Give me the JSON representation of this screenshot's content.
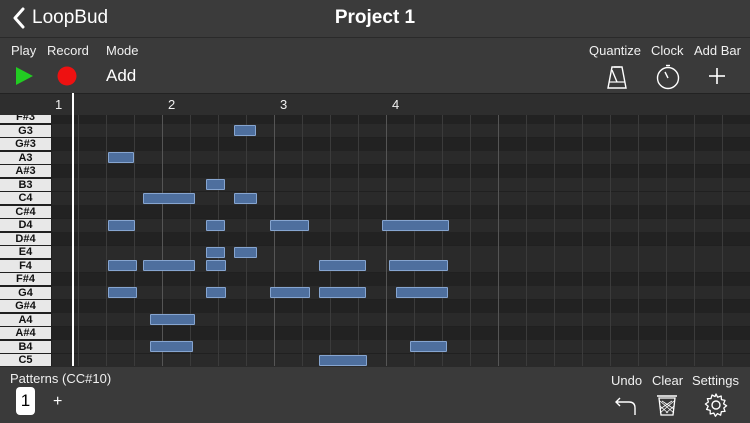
{
  "nav": {
    "back_label": "LoopBud",
    "title": "Project 1"
  },
  "toolbar": {
    "play_label": "Play",
    "record_label": "Record",
    "mode_label": "Mode",
    "mode_value": "Add",
    "quantize_label": "Quantize",
    "clock_label": "Clock",
    "addbar_label": "Add Bar",
    "colors": {
      "play": "#22cc22",
      "record": "#ee1111"
    }
  },
  "ruler": {
    "bars": [
      "1",
      "2",
      "3",
      "4"
    ]
  },
  "keys": [
    "F#3",
    "G3",
    "G#3",
    "A3",
    "A#3",
    "B3",
    "C4",
    "C#4",
    "D4",
    "D#4",
    "E4",
    "F4",
    "F#4",
    "G4",
    "G#4",
    "A4",
    "A#4",
    "B4",
    "C5"
  ],
  "bottom": {
    "patterns_label": "Patterns (CC#10)",
    "pattern_current": "1",
    "add_pattern": "+",
    "undo_label": "Undo",
    "clear_label": "Clear",
    "settings_label": "Settings"
  }
}
